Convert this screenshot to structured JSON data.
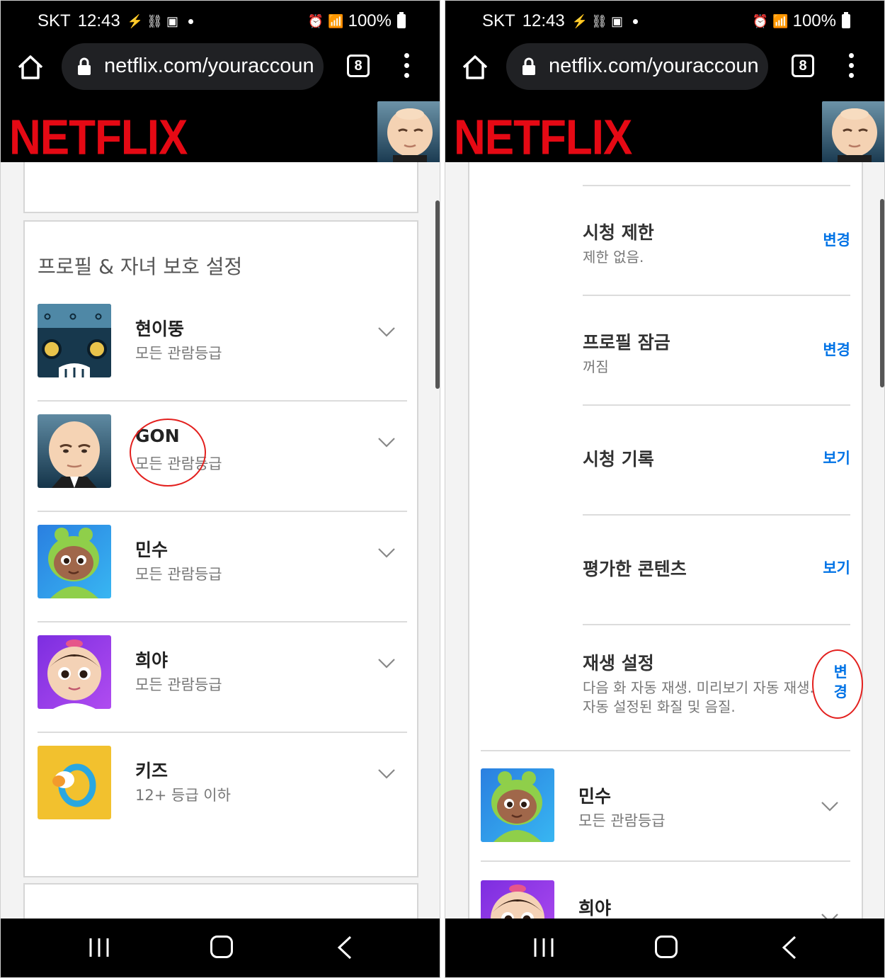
{
  "status_bar": {
    "carrier": "SKT",
    "time": "12:43",
    "battery": "100%"
  },
  "browser": {
    "url": "netflix.com/youraccoun",
    "tab_count": "8"
  },
  "brand": {
    "logo_text": "NETFLIX",
    "logo_color": "#e50914"
  },
  "left_screen": {
    "section_title": "프로필 & 자녀 보호 설정",
    "profiles": [
      {
        "name": "현이뚱",
        "rating": "모든 관람등급",
        "avatar": "robot-avatar-icon"
      },
      {
        "name": "GON",
        "rating": "모든 관람등급",
        "avatar": "boss-baby-avatar-icon"
      },
      {
        "name": "민수",
        "rating": "모든 관람등급",
        "avatar": "frog-baby-avatar-icon"
      },
      {
        "name": "희야",
        "rating": "모든 관람등급",
        "avatar": "girl-baby-avatar-icon"
      },
      {
        "name": "키즈",
        "rating": "12+ 등급 이하",
        "avatar": "kids-pacifier-avatar-icon"
      }
    ]
  },
  "right_screen": {
    "settings": [
      {
        "title": "시청 제한",
        "subtitle": "제한 없음.",
        "action": "변경"
      },
      {
        "title": "프로필 잠금",
        "subtitle": "꺼짐",
        "action": "변경"
      },
      {
        "title": "시청 기록",
        "subtitle": "",
        "action": "보기"
      },
      {
        "title": "평가한 콘텐츠",
        "subtitle": "",
        "action": "보기"
      },
      {
        "title": "재생 설정",
        "subtitle_line1": "다음 화 자동 재생. 미리보기 자동 재생.",
        "subtitle_line2": "자동 설정된 화질 및 음질.",
        "action_line1": "변",
        "action_line2": "경"
      }
    ],
    "profiles": [
      {
        "name": "민수",
        "rating": "모든 관람등급"
      },
      {
        "name": "희야",
        "rating": ""
      }
    ]
  },
  "colors": {
    "link": "#0073e6",
    "annotation": "#e3201e"
  }
}
